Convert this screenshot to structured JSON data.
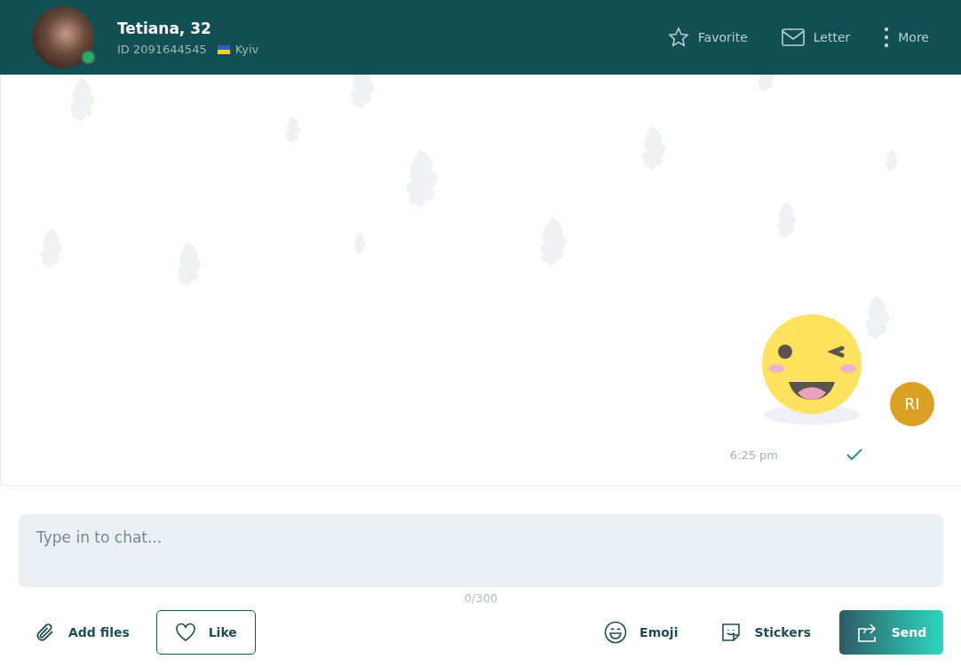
{
  "profile": {
    "name": "Tetiana, 32",
    "id": "ID 2091644545",
    "location": "Kyiv",
    "online": true
  },
  "actions": [
    {
      "kind": "favorite",
      "label": "Favorite"
    },
    {
      "kind": "letter",
      "label": "Letter"
    },
    {
      "kind": "more",
      "label": "More"
    }
  ],
  "messages": [
    {
      "kind": "sticker",
      "time": "6:25 pm",
      "read": true,
      "sender_initials": "RI"
    }
  ],
  "composer": {
    "placeholder": "Type in to chat...",
    "counter": "0/300"
  },
  "toolbar": [
    {
      "kind": "files",
      "label": "Add files"
    },
    {
      "kind": "like",
      "label": "Like"
    },
    {
      "kind": "emoji",
      "label": "Emoji"
    },
    {
      "kind": "stickers",
      "label": "Stickers"
    },
    {
      "kind": "send",
      "label": "Send"
    }
  ]
}
